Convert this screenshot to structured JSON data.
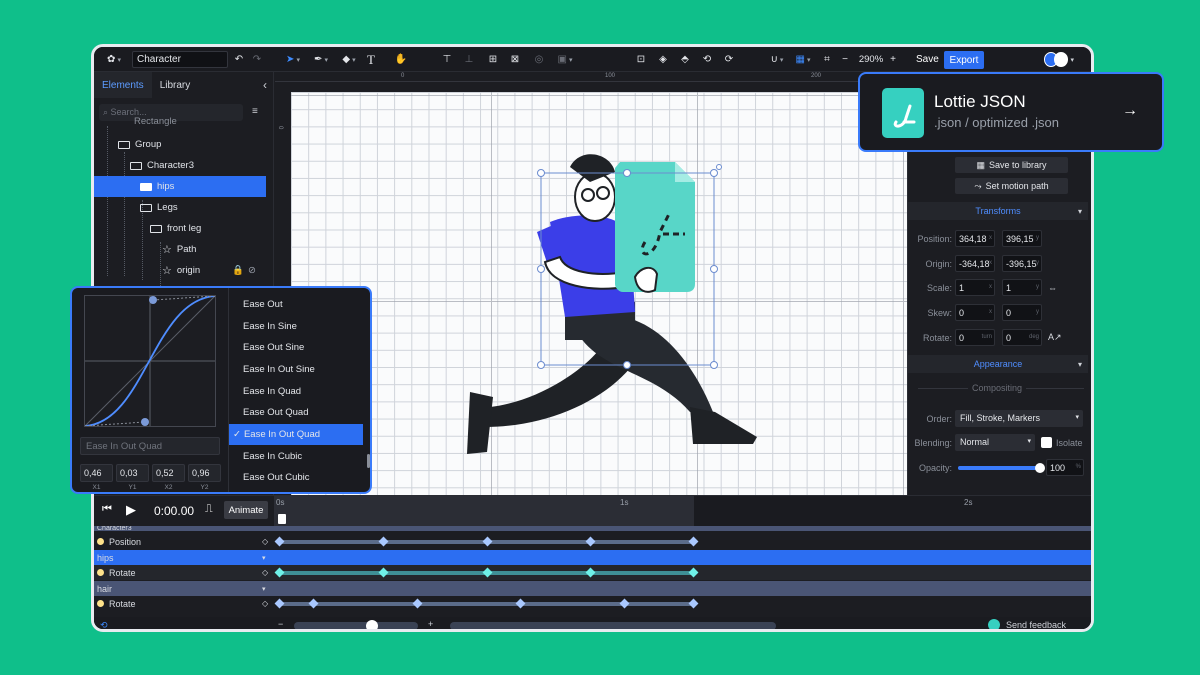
{
  "toolbar": {
    "document_name": "Character",
    "zoom": "290%",
    "save_label": "Save",
    "export_label": "Export"
  },
  "left_panel": {
    "tabs": [
      "Elements",
      "Library"
    ],
    "search_placeholder": "Search...",
    "tree": [
      {
        "label": "Rectangle",
        "indent": 0,
        "type": "path"
      },
      {
        "label": "Group",
        "indent": 1,
        "type": "folder"
      },
      {
        "label": "Character3",
        "indent": 2,
        "type": "folder"
      },
      {
        "label": "hips",
        "indent": 3,
        "type": "folder",
        "selected": true
      },
      {
        "label": "Legs",
        "indent": 3,
        "type": "folder"
      },
      {
        "label": "front leg",
        "indent": 4,
        "type": "folder"
      },
      {
        "label": "Path",
        "indent": 5,
        "type": "path"
      },
      {
        "label": "origin",
        "indent": 5,
        "type": "path"
      }
    ]
  },
  "canvas": {
    "ruler_ticks": [
      "0",
      "100",
      "200"
    ]
  },
  "right_panel": {
    "save_to_library": "Save to library",
    "set_motion_path": "Set motion path",
    "transforms_label": "Transforms",
    "position_label": "Position:",
    "position_x": "364,18",
    "position_y": "396,15",
    "origin_label": "Origin:",
    "origin_x": "-364,18",
    "origin_y": "-396,15",
    "scale_label": "Scale:",
    "scale_x": "1",
    "scale_y": "1",
    "skew_label": "Skew:",
    "skew_x": "0",
    "skew_y": "0",
    "rotate_label": "Rotate:",
    "rotate_turn": "0",
    "rotate_deg": "0",
    "unit_x": "x",
    "unit_y": "y",
    "unit_turn": "turn",
    "unit_deg": "deg",
    "appearance_label": "Appearance",
    "compositing_label": "Compositing",
    "order_label": "Order:",
    "order_value": "Fill, Stroke, Markers",
    "blending_label": "Blending:",
    "blending_value": "Normal",
    "isolate_label": "Isolate",
    "opacity_label": "Opacity:",
    "opacity_value": "100",
    "opacity_unit": "%",
    "opacity_level": 1.0
  },
  "timeline": {
    "time": "0:00.00",
    "animate_label": "Animate",
    "ticks": [
      "0s",
      "1s",
      "2s"
    ],
    "rows": [
      {
        "label": "Character3",
        "kind": "group"
      },
      {
        "label": "Position",
        "kind": "prop"
      },
      {
        "label": "hips",
        "kind": "group-selected"
      },
      {
        "label": "Rotate",
        "kind": "prop"
      },
      {
        "label": "hair",
        "kind": "group"
      },
      {
        "label": "Rotate",
        "kind": "prop"
      }
    ],
    "send_feedback": "Send feedback"
  },
  "ease_popup": {
    "options": [
      "Ease Out",
      "Ease In Sine",
      "Ease Out Sine",
      "Ease In Out Sine",
      "Ease In Quad",
      "Ease Out Quad",
      "Ease In Out Quad",
      "Ease In Cubic",
      "Ease Out Cubic"
    ],
    "selected": "Ease In Out Quad",
    "name_placeholder": "Ease In Out Quad",
    "values": [
      "0,46",
      "0,03",
      "0,52",
      "0,96"
    ],
    "value_labels": [
      "X1",
      "Y1",
      "X2",
      "Y2"
    ]
  },
  "lottie_card": {
    "title": "Lottie JSON",
    "subtitle": ".json / optimized .json"
  }
}
